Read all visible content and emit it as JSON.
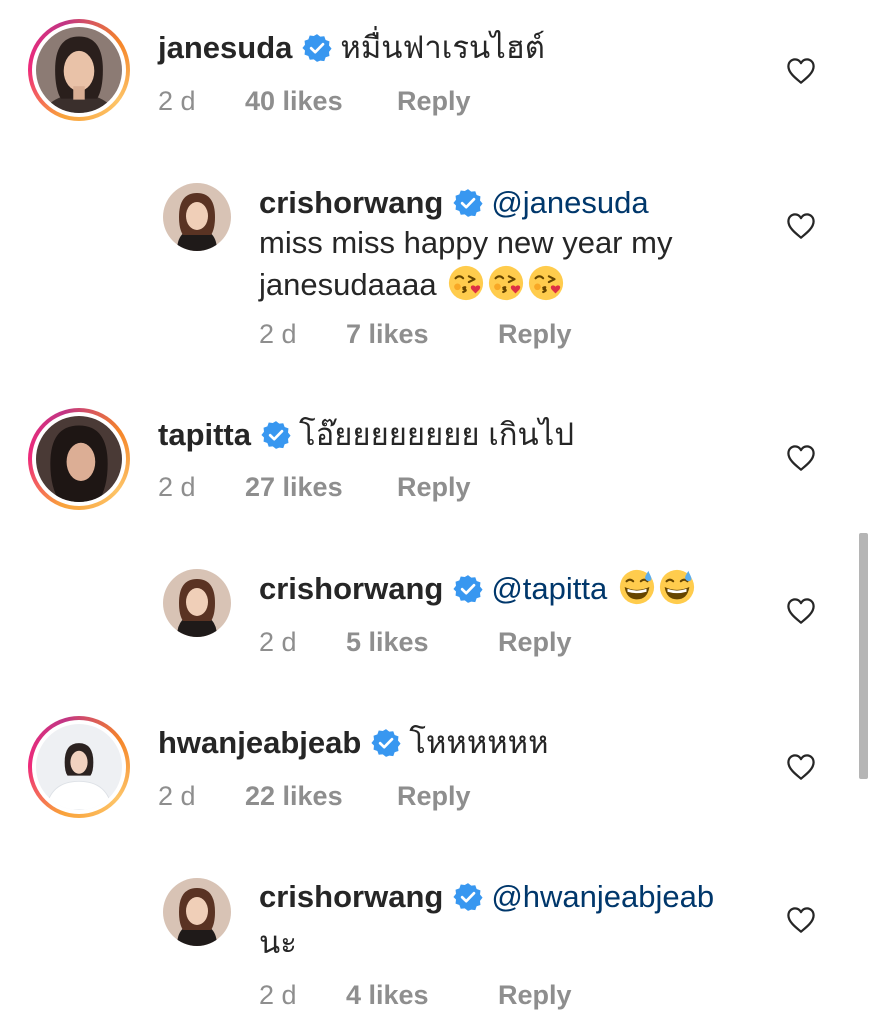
{
  "comments": [
    {
      "username": "janesuda",
      "text": "หมื่นฟาเรนไฮต์",
      "time": "2 d",
      "likes": "40 likes",
      "reply": "Reply"
    },
    {
      "username": "crishorwang",
      "mention": "@janesuda",
      "line2": "miss miss happy new year my",
      "line3": "janesudaaaa",
      "emoji": "face-blowing-kiss",
      "time": "2 d",
      "likes": "7 likes",
      "reply": "Reply"
    },
    {
      "username": "tapitta",
      "text": "โอ๊ยยยยยยยย เกินไป",
      "time": "2 d",
      "likes": "27 likes",
      "reply": "Reply"
    },
    {
      "username": "crishorwang",
      "mention": "@tapitta",
      "emoji": "grinning-face-with-sweat",
      "time": "2 d",
      "likes": "5 likes",
      "reply": "Reply"
    },
    {
      "username": "hwanjeabjeab",
      "text": "โหหหหหห",
      "time": "2 d",
      "likes": "22 likes",
      "reply": "Reply"
    },
    {
      "username": "crishorwang",
      "mention": "@hwanjeabjeab",
      "line2": "นะ",
      "time": "2 d",
      "likes": "4 likes",
      "reply": "Reply"
    }
  ],
  "icons": {
    "verified": "verified-badge-icon",
    "like": "heart-outline-icon"
  },
  "colors": {
    "verified": "#3897f0",
    "meta": "#8e8e8e",
    "mention": "#00376b",
    "text": "#262626"
  }
}
